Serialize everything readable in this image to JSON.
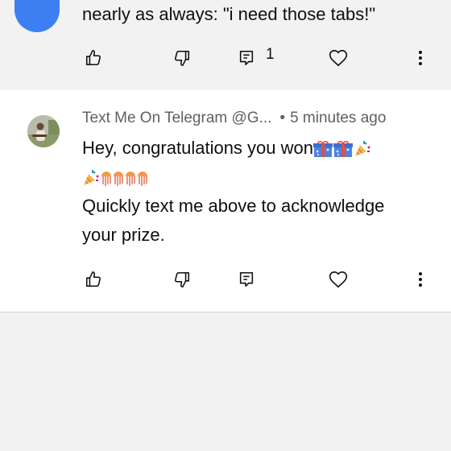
{
  "comment1": {
    "text": "nearly as always: \"i need those tabs!\"",
    "reply_count": "1"
  },
  "comment2": {
    "author": "Text Me On Telegram @G...",
    "time": "5 minutes ago",
    "line1": "Hey, congratulations you won",
    "line3": "Quickly text me above to acknowledge",
    "line4": "your prize."
  },
  "icons": [
    "thumb-up-icon",
    "thumb-down-icon",
    "reply-icon",
    "heart-icon",
    "more-vert-icon",
    "gift-emoji",
    "confetti-emoji",
    "jellyfish-emoji"
  ],
  "colors": {
    "text": "#0f0f0f",
    "meta": "#606060",
    "avatar_blue": "#3d7ff2",
    "page_bg": "#f2f2f2"
  }
}
